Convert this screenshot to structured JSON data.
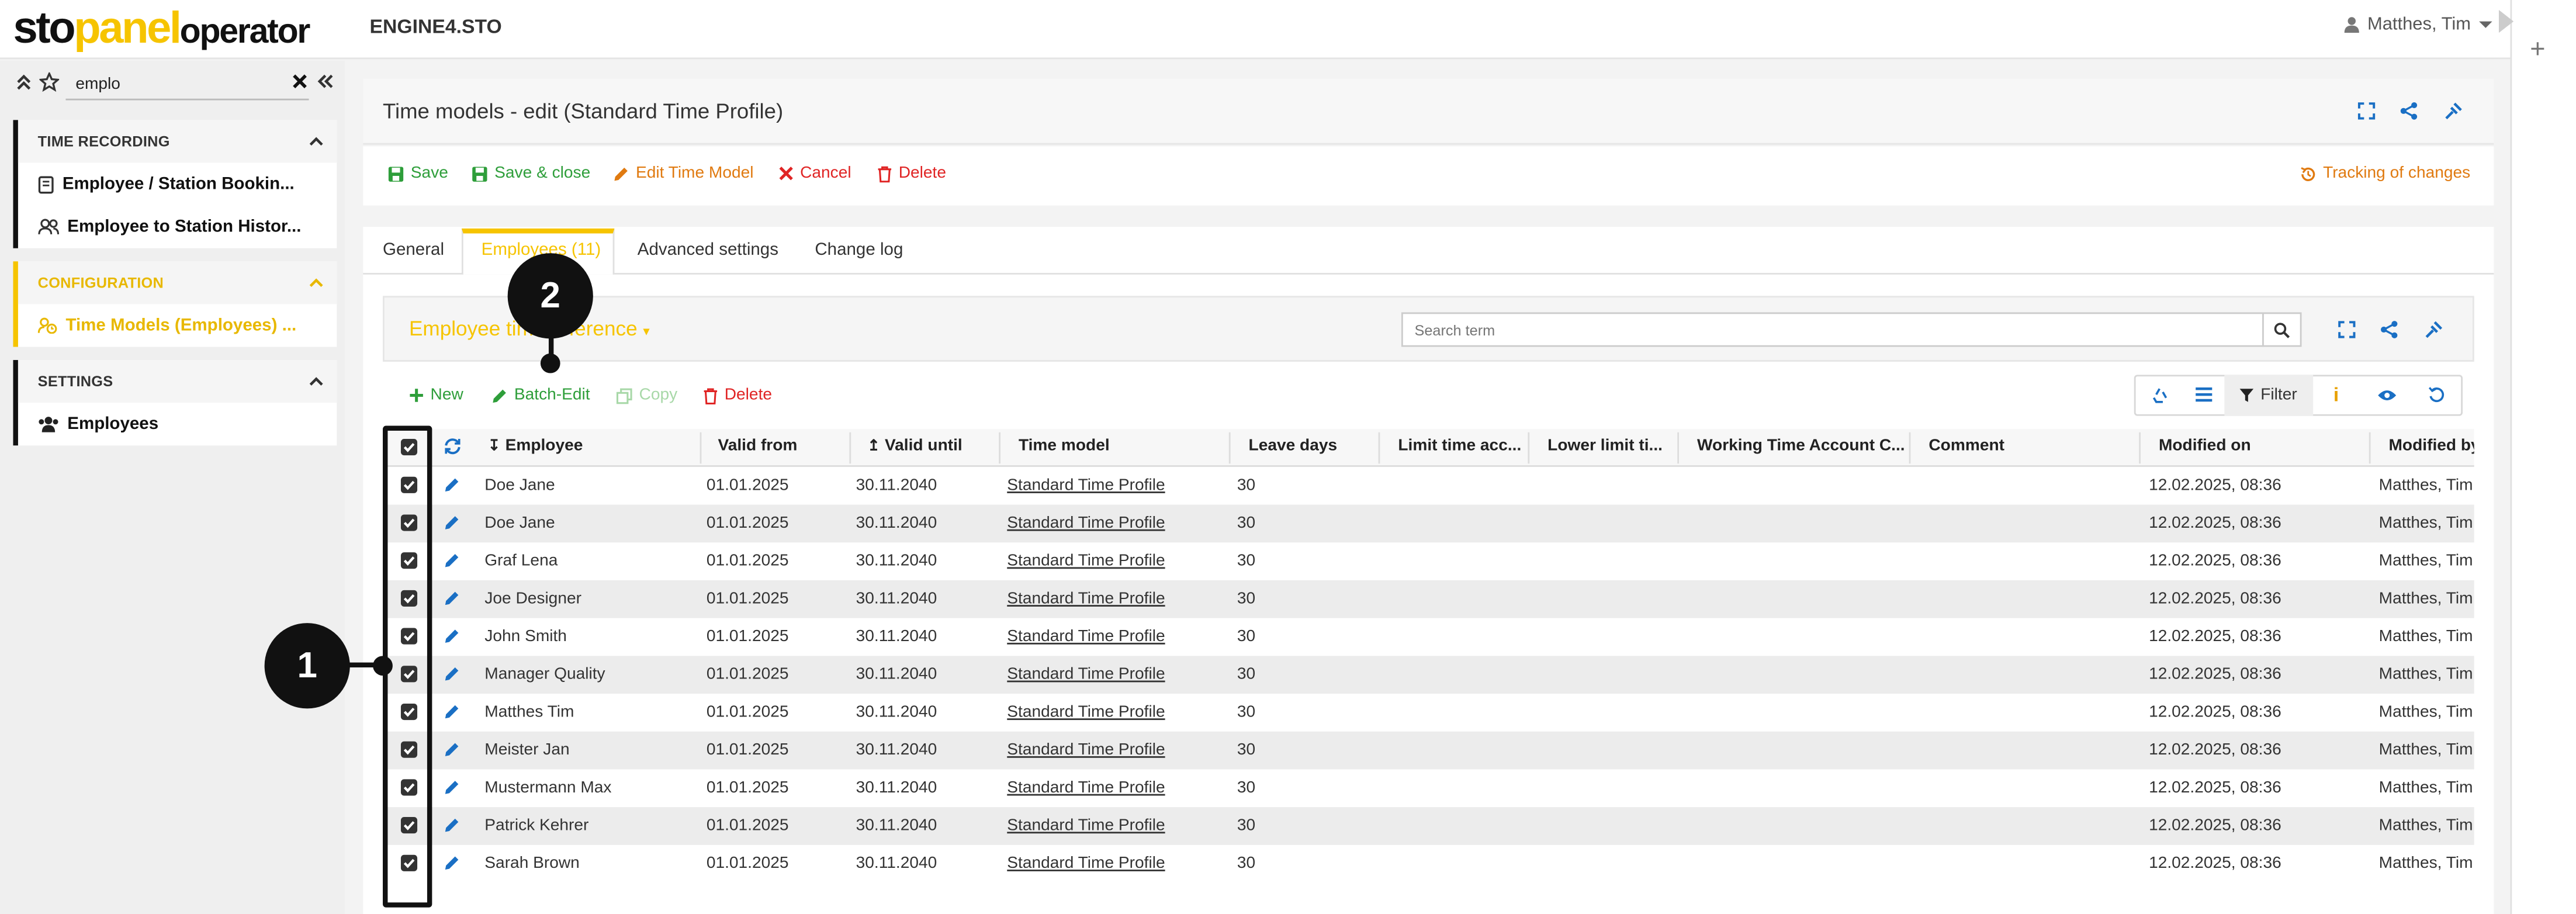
{
  "app": {
    "logo_sto": "sto",
    "logo_panel": "panel",
    "logo_operator": "operator",
    "tenant": "ENGINE4.STO",
    "user": "Matthes, Tim"
  },
  "sidebar": {
    "search_value": "emplo",
    "sections": [
      {
        "title": "TIME RECORDING",
        "items": [
          "Employee / Station Bookin...",
          "Employee to Station Histor..."
        ]
      },
      {
        "title": "CONFIGURATION",
        "items": [
          "Time Models (Employees) ..."
        ]
      },
      {
        "title": "SETTINGS",
        "items": [
          "Employees"
        ]
      }
    ]
  },
  "page": {
    "title": "Time models - edit (Standard Time Profile)",
    "toolbar": {
      "save": "Save",
      "save_close": "Save & close",
      "edit_model": "Edit Time Model",
      "cancel": "Cancel",
      "delete": "Delete",
      "tracking": "Tracking of changes"
    },
    "tabs": [
      "General",
      "Employees (11)",
      "Advanced settings",
      "Change log"
    ]
  },
  "panel": {
    "title": "Employee time reference",
    "search_placeholder": "Search term",
    "actions": {
      "new": "New",
      "batch_edit": "Batch-Edit",
      "copy": "Copy",
      "delete": "Delete"
    },
    "filter_label": "Filter"
  },
  "table": {
    "columns": [
      "Employee",
      "Valid from",
      "Valid until",
      "Time model",
      "Leave days",
      "Limit time acc...",
      "Lower limit ti...",
      "Working Time Account C...",
      "Comment",
      "Modified on",
      "Modified by"
    ],
    "rows": [
      {
        "employee": "Doe Jane",
        "from": "01.01.2025",
        "until": "30.11.2040",
        "model": "Standard Time Profile",
        "leave": "30",
        "modified": "12.02.2025, 08:36",
        "by": "Matthes, Tim"
      },
      {
        "employee": "Doe Jane",
        "from": "01.01.2025",
        "until": "30.11.2040",
        "model": "Standard Time Profile",
        "leave": "30",
        "modified": "12.02.2025, 08:36",
        "by": "Matthes, Tim"
      },
      {
        "employee": "Graf Lena",
        "from": "01.01.2025",
        "until": "30.11.2040",
        "model": "Standard Time Profile",
        "leave": "30",
        "modified": "12.02.2025, 08:36",
        "by": "Matthes, Tim"
      },
      {
        "employee": "Joe Designer",
        "from": "01.01.2025",
        "until": "30.11.2040",
        "model": "Standard Time Profile",
        "leave": "30",
        "modified": "12.02.2025, 08:36",
        "by": "Matthes, Tim"
      },
      {
        "employee": "John Smith",
        "from": "01.01.2025",
        "until": "30.11.2040",
        "model": "Standard Time Profile",
        "leave": "30",
        "modified": "12.02.2025, 08:36",
        "by": "Matthes, Tim"
      },
      {
        "employee": "Manager Quality",
        "from": "01.01.2025",
        "until": "30.11.2040",
        "model": "Standard Time Profile",
        "leave": "30",
        "modified": "12.02.2025, 08:36",
        "by": "Matthes, Tim"
      },
      {
        "employee": "Matthes Tim",
        "from": "01.01.2025",
        "until": "30.11.2040",
        "model": "Standard Time Profile",
        "leave": "30",
        "modified": "12.02.2025, 08:36",
        "by": "Matthes, Tim"
      },
      {
        "employee": "Meister Jan",
        "from": "01.01.2025",
        "until": "30.11.2040",
        "model": "Standard Time Profile",
        "leave": "30",
        "modified": "12.02.2025, 08:36",
        "by": "Matthes, Tim"
      },
      {
        "employee": "Mustermann Max",
        "from": "01.01.2025",
        "until": "30.11.2040",
        "model": "Standard Time Profile",
        "leave": "30",
        "modified": "12.02.2025, 08:36",
        "by": "Matthes, Tim"
      },
      {
        "employee": "Patrick Kehrer",
        "from": "01.01.2025",
        "until": "30.11.2040",
        "model": "Standard Time Profile",
        "leave": "30",
        "modified": "12.02.2025, 08:36",
        "by": "Matthes, Tim"
      },
      {
        "employee": "Sarah Brown",
        "from": "01.01.2025",
        "until": "30.11.2040",
        "model": "Standard Time Profile",
        "leave": "30",
        "modified": "12.02.2025, 08:36",
        "by": "Matthes, Tim"
      }
    ]
  },
  "annotations": {
    "one": "1",
    "two": "2"
  },
  "colors": {
    "accent": "#f6c400",
    "save_green": "#2e9e3a",
    "edit_orange": "#e07a10",
    "danger_red": "#e02424",
    "link_blue": "#1a6fc4"
  }
}
